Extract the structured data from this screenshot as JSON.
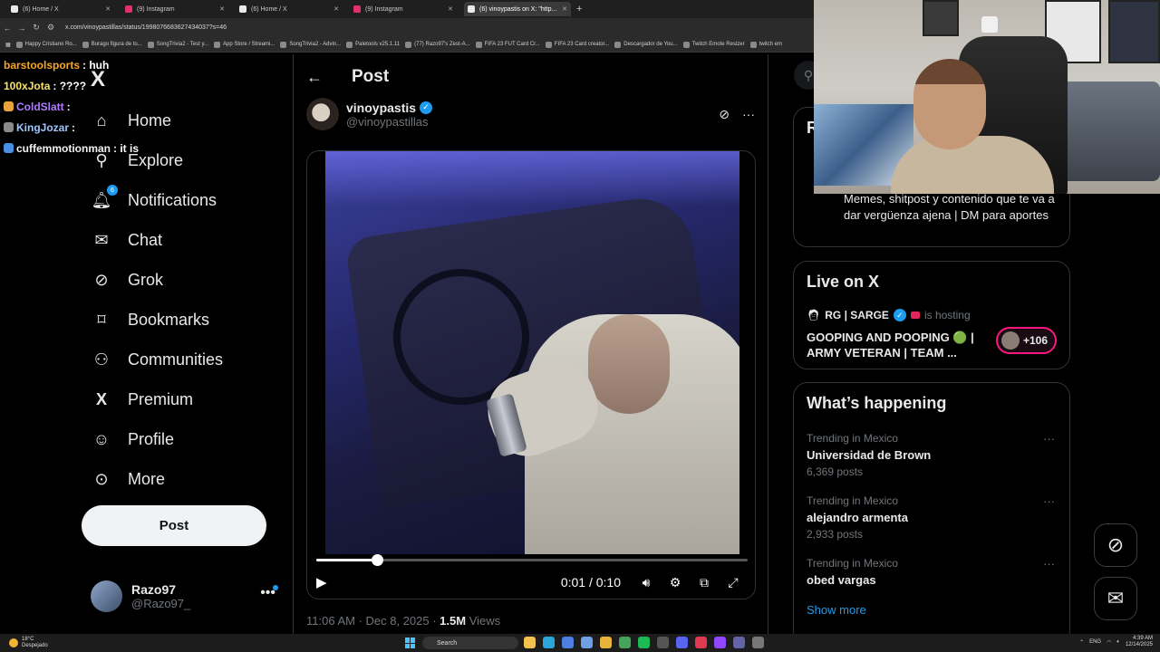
{
  "browser": {
    "tabs": [
      {
        "label": "(6) Home / X",
        "favicon_color": "#e7e9ea",
        "active": false
      },
      {
        "label": "(9) Instagram",
        "favicon_color": "#e1306c",
        "active": false
      },
      {
        "label": "(6) Home / X",
        "favicon_color": "#e7e9ea",
        "active": false
      },
      {
        "label": "(9) Instagram",
        "favicon_color": "#e1306c",
        "active": false
      },
      {
        "label": "(6) vinoypastis on X: \"http...",
        "favicon_color": "#e7e9ea",
        "active": true
      }
    ],
    "new_tab": "+",
    "url": "x.com/vinoypastillas/status/1998076683627434037?s=46",
    "bookmarks": [
      "Happy Cristiano Ro...",
      "Burago figura de to...",
      "SongTrivia2 - Test y...",
      "App Store / Streami...",
      "SongTrivia2 - Advin...",
      "Paletools v25.1.11",
      "(77) Razo97's Zest-A...",
      "FIFA 23 FUT Card Cr...",
      "FIFA 23 Card creator...",
      "Descargador de You...",
      "Twitch Emote Resizer",
      "twitch em"
    ]
  },
  "chat": [
    {
      "user": "barstoolsports",
      "msg": ": huh",
      "color": "#f5a623",
      "badge": ""
    },
    {
      "user": "100xJota",
      "msg": ": ????",
      "color": "#f7e26b",
      "badge": ""
    },
    {
      "user": "ColdSlatt",
      "msg": ":",
      "color": "#b07cff",
      "badge": "#e8a33d"
    },
    {
      "user": "KingJozar",
      "msg": ":",
      "color": "#9fc5ff",
      "badge": "#8a8a8a"
    },
    {
      "user": "cuffemmotionman",
      "msg": ": it is",
      "color": "#f2f2f2",
      "badge": "#4a90e2"
    }
  ],
  "nav": {
    "logo": "X",
    "items": [
      {
        "label": "Home",
        "icon": "home-icon",
        "glyph": "⌂"
      },
      {
        "label": "Explore",
        "icon": "search-icon",
        "glyph": "⚲"
      },
      {
        "label": "Notifications",
        "icon": "bell-icon",
        "glyph": "♫",
        "badge": "6"
      },
      {
        "label": "Chat",
        "icon": "mail-icon",
        "glyph": "✉"
      },
      {
        "label": "Grok",
        "icon": "grok-icon",
        "glyph": "⊘"
      },
      {
        "label": "Bookmarks",
        "icon": "bookmark-icon",
        "glyph": "⎕"
      },
      {
        "label": "Communities",
        "icon": "communities-icon",
        "glyph": "⚇"
      },
      {
        "label": "Premium",
        "icon": "premium-x-icon",
        "glyph": "X"
      },
      {
        "label": "Profile",
        "icon": "person-icon",
        "glyph": "☺"
      },
      {
        "label": "More",
        "icon": "more-circle-icon",
        "glyph": "⊙"
      }
    ],
    "post_label": "Post",
    "account": {
      "name": "Razo97",
      "handle": "@Razo97_",
      "more": "•••"
    }
  },
  "post": {
    "back": "←",
    "title": "Post",
    "author_name": "vinoypastis",
    "author_handle": "@vinoypastillas",
    "verified": "✓",
    "video": {
      "current_time": "0:01",
      "duration": "0:10",
      "time_display": "0:01 / 0:10",
      "progress": 0.14,
      "play": "▶"
    },
    "timestamp": "11:06 AM · Dec 8, 2025 · ",
    "views_count": "1.5M",
    "views_label": "Views"
  },
  "sidebar": {
    "profile_desc": "Memes, shitpost y contenido que te va a dar vergüenza ajena | DM para aportes",
    "live": {
      "title": "Live on X",
      "host": "RG | SARGE",
      "hosting": "is hosting",
      "stream_title": "GOOPING AND POOPING 🟢 | ARMY VETERAN | TEAM ...",
      "listeners": "+106"
    },
    "happening": {
      "title": "What’s happening",
      "trends": [
        {
          "location": "Trending in Mexico",
          "name": "Universidad de Brown",
          "count": "6,369 posts"
        },
        {
          "location": "Trending in Mexico",
          "name": "alejandro armenta",
          "count": "2,933 posts"
        },
        {
          "location": "Trending in Mexico",
          "name": "obed vargas",
          "count": ""
        }
      ],
      "show_more": "Show more",
      "more": "···"
    }
  },
  "taskbar": {
    "temp": "18°C",
    "weather": "Despejado",
    "search": "Search",
    "lang": "ENG",
    "time": "4:39 AM",
    "date": "12/14/2025"
  },
  "colors": {
    "accent": "#1d9bf0",
    "live_ring": "#f91880",
    "background": "#000000",
    "muted": "#71767b"
  }
}
